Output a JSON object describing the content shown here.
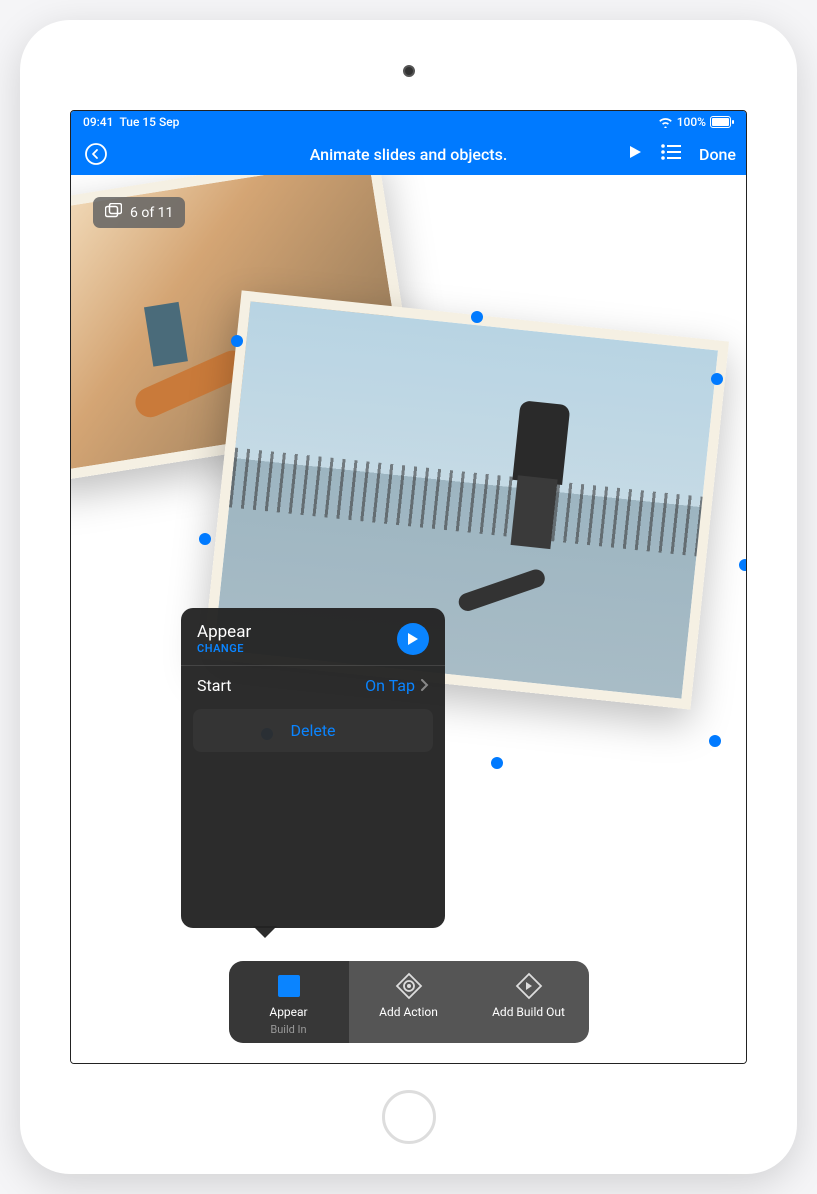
{
  "status": {
    "time": "09:41",
    "date": "Tue 15 Sep",
    "battery": "100%"
  },
  "nav": {
    "title": "Animate slides and objects.",
    "done": "Done"
  },
  "slideCounter": "6 of 11",
  "popup": {
    "title": "Appear",
    "change": "CHANGE",
    "startLabel": "Start",
    "startValue": "On Tap",
    "delete": "Delete"
  },
  "bottomBar": {
    "item1": {
      "label": "Appear",
      "sublabel": "Build In"
    },
    "item2": {
      "label": "Add Action"
    },
    "item3": {
      "label": "Add Build Out"
    }
  },
  "colors": {
    "accent": "#007aff",
    "link": "#0a84ff"
  }
}
